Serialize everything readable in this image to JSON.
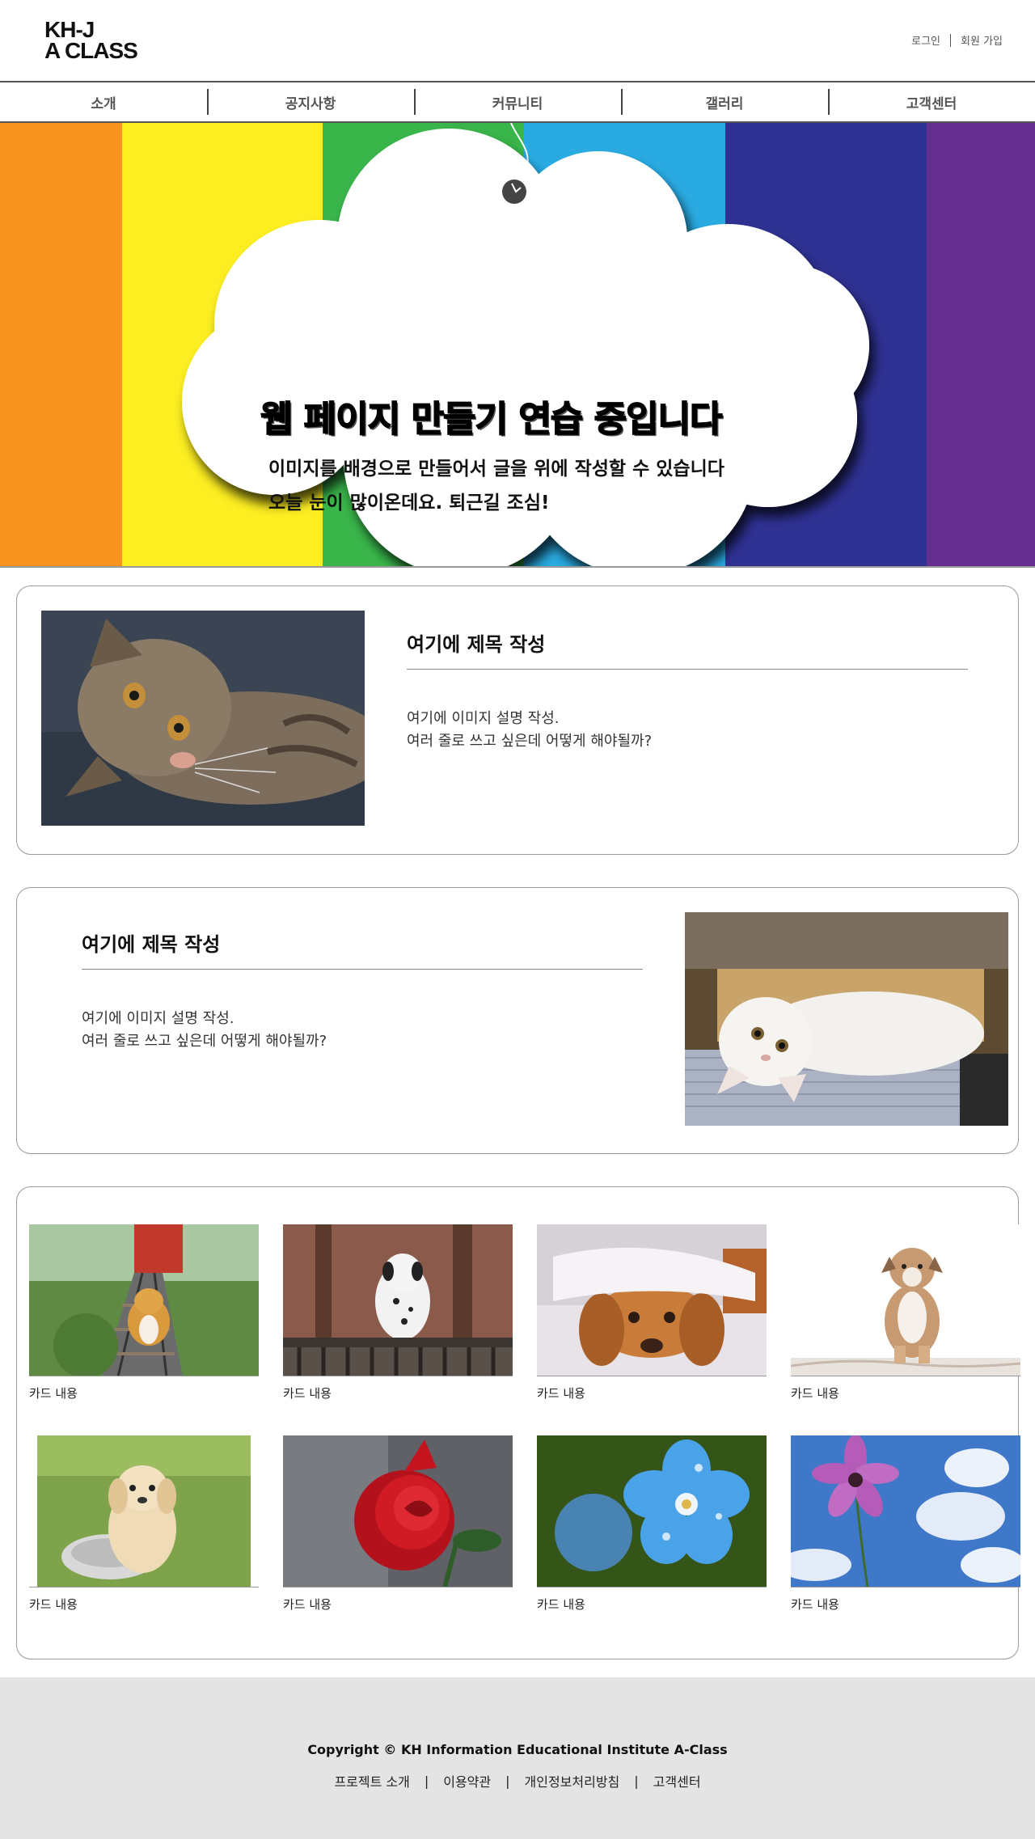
{
  "header": {
    "logo_line1": "KH-J",
    "logo_line2": "A CLASS",
    "login_label": "로그인",
    "signup_label": "회원 가입"
  },
  "nav": {
    "items": [
      {
        "label": "소개"
      },
      {
        "label": "공지사항"
      },
      {
        "label": "커뮤니티"
      },
      {
        "label": "갤러리"
      },
      {
        "label": "고객센터"
      }
    ]
  },
  "hero": {
    "stripe_colors": [
      "#f7931e",
      "#fcee21",
      "#39b54a",
      "#29abe2",
      "#2e3192",
      "#662d91"
    ],
    "title": "웹 페이지 만들기 연습 중입니다",
    "line1": "이미지를 배경으로 만들어서 글을 위에 작성할 수 있습니다",
    "line2": "오늘 눈이 많이온데요. 퇴근길 조심!"
  },
  "features": [
    {
      "title": "여기에 제목 작성",
      "desc_line1": "여기에 이미지 설명 작성.",
      "desc_line2": "여러 줄로 쓰고 싶은데 어떻게 해야될까?",
      "image": "tabby-kitten"
    },
    {
      "title": "여기에 제목 작성",
      "desc_line1": "여기에 이미지 설명 작성.",
      "desc_line2": "여러 줄로 쓰고 싶은데 어떻게 해야될까?",
      "image": "white-kitten"
    }
  ],
  "gallery": {
    "cards": [
      {
        "text": "카드 내용",
        "image": "corgi-on-tracks"
      },
      {
        "text": "카드 내용",
        "image": "dalmatian"
      },
      {
        "text": "카드 내용",
        "image": "spaniel-under-blanket"
      },
      {
        "text": "카드 내용",
        "image": "bulldog-puppy"
      },
      {
        "text": "카드 내용",
        "image": "golden-puppy"
      },
      {
        "text": "카드 내용",
        "image": "red-rose"
      },
      {
        "text": "카드 내용",
        "image": "blue-flower"
      },
      {
        "text": "카드 내용",
        "image": "pink-cosmos"
      }
    ]
  },
  "footer": {
    "copyright": "Copyright © KH Information Educational Institute A-Class",
    "links": [
      {
        "label": "프로젝트 소개"
      },
      {
        "label": "이용약관"
      },
      {
        "label": "개인정보처리방침"
      },
      {
        "label": "고객센터"
      }
    ]
  }
}
